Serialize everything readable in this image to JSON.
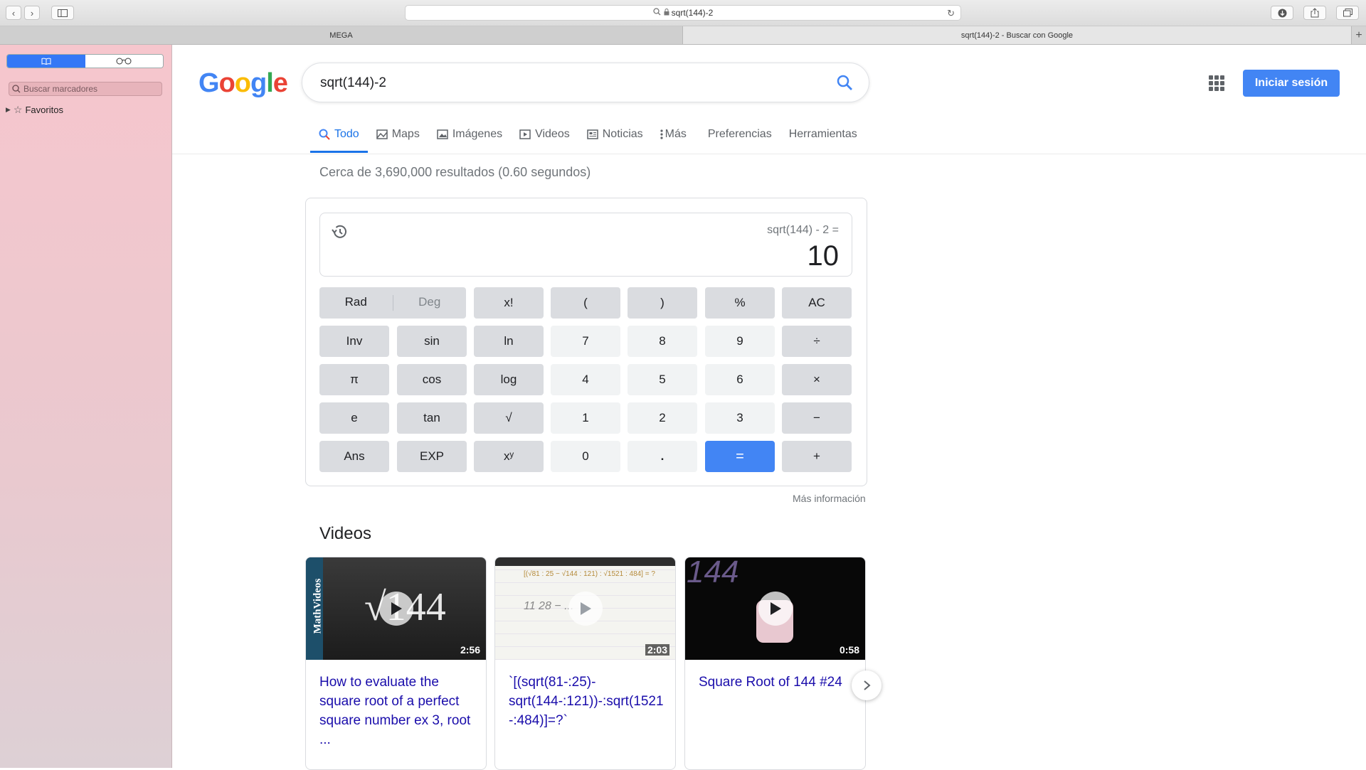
{
  "browser": {
    "url": "sqrt(144)-2",
    "tabs": [
      "MEGA",
      "sqrt(144)-2 - Buscar con Google"
    ],
    "new_tab": "+"
  },
  "sidebar": {
    "bookmarks_placeholder": "Buscar marcadores",
    "favorites": "Favoritos"
  },
  "google": {
    "logo": "Google",
    "query": "sqrt(144)-2",
    "signin": "Iniciar sesión",
    "nav": [
      {
        "label": "Todo",
        "icon": "search-icon"
      },
      {
        "label": "Maps",
        "icon": "map-icon"
      },
      {
        "label": "Imágenes",
        "icon": "image-icon"
      },
      {
        "label": "Videos",
        "icon": "video-icon"
      },
      {
        "label": "Noticias",
        "icon": "news-icon"
      },
      {
        "label": "Más",
        "icon": "more-icon"
      },
      {
        "label": "Preferencias",
        "icon": ""
      },
      {
        "label": "Herramientas",
        "icon": ""
      }
    ],
    "stats": "Cerca de 3,690,000 resultados (0.60 segundos)"
  },
  "calculator": {
    "expression": "sqrt(144) - 2 =",
    "result": "10",
    "keys": {
      "rad": "Rad",
      "deg": "Deg",
      "fact": "x!",
      "lparen": "(",
      "rparen": ")",
      "percent": "%",
      "ac": "AC",
      "inv": "Inv",
      "sin": "sin",
      "ln": "ln",
      "n7": "7",
      "n8": "8",
      "n9": "9",
      "div": "÷",
      "pi": "π",
      "cos": "cos",
      "log": "log",
      "n4": "4",
      "n5": "5",
      "n6": "6",
      "mul": "×",
      "e": "e",
      "tan": "tan",
      "sqrt": "√",
      "n1": "1",
      "n2": "2",
      "n3": "3",
      "sub": "−",
      "ans": "Ans",
      "exp": "EXP",
      "pow": "xʸ",
      "n0": "0",
      "dot": ".",
      "eq": "=",
      "add": "+"
    },
    "more_info": "Más información"
  },
  "videos": {
    "heading": "Videos",
    "items": [
      {
        "title": "How to evaluate the square root of a perfect square number ex 3, root ...",
        "duration": "2:56",
        "channel": "MathVideos"
      },
      {
        "title": "`[(sqrt(81-:25)-sqrt(144-:121))-:sqrt(1521-:484)]=?`",
        "duration": "2:03"
      },
      {
        "title": "Square Root of 144 #24",
        "duration": "0:58"
      }
    ]
  },
  "colors": {
    "google_blue": "#4285f4",
    "link": "#1a0dab",
    "sidebar_pink": "#f6c6cd"
  }
}
